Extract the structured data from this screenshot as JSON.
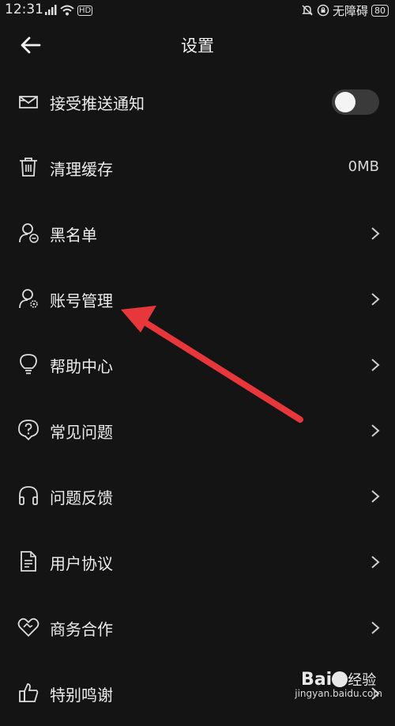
{
  "status_bar": {
    "time": "12:31",
    "network_label": "HD",
    "accessibility_label": "无障碍",
    "battery": "80"
  },
  "header": {
    "title": "设置"
  },
  "settings": {
    "items": [
      {
        "label": "接受推送通知",
        "icon": "message-icon",
        "control": "toggle",
        "toggle_on": false
      },
      {
        "label": "清理缓存",
        "icon": "trash-icon",
        "value": "0MB"
      },
      {
        "label": "黑名单",
        "icon": "user-minus-icon",
        "control": "chevron"
      },
      {
        "label": "账号管理",
        "icon": "user-gear-icon",
        "control": "chevron"
      },
      {
        "label": "帮助中心",
        "icon": "lightbulb-icon",
        "control": "chevron"
      },
      {
        "label": "常见问题",
        "icon": "question-icon",
        "control": "chevron"
      },
      {
        "label": "问题反馈",
        "icon": "headphones-icon",
        "control": "chevron"
      },
      {
        "label": "用户协议",
        "icon": "document-icon",
        "control": "chevron"
      },
      {
        "label": "商务合作",
        "icon": "handshake-icon",
        "control": "chevron"
      },
      {
        "label": "特别鸣谢",
        "icon": "thumbs-up-icon",
        "control": "chevron"
      }
    ]
  },
  "annotation": {
    "color": "#e8373a"
  },
  "watermark": {
    "brand": "Bai",
    "brand_suffix": "经验",
    "url": "jingyan.baidu.com"
  }
}
